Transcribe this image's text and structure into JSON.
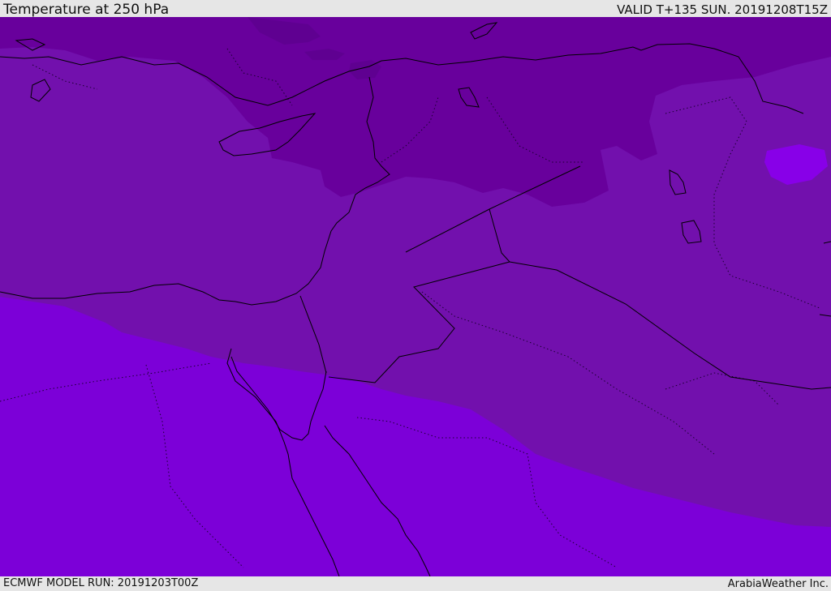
{
  "header": {
    "title": "Temperature at 250 hPa",
    "valid_time": "VALID T+135 SUN. 20191208T15Z"
  },
  "footer": {
    "model_run": "ECMWF MODEL RUN: 20191203T00Z",
    "credit": "ArabiaWeather Inc."
  },
  "colors": {
    "band_coldest": "#5f0091",
    "band_cold": "#68009c",
    "band_mid": "#7210ad",
    "band_warm": "#7c00d8",
    "band_warmest": "#8800e8",
    "coastline": "#000000",
    "border": "#1a0030"
  }
}
